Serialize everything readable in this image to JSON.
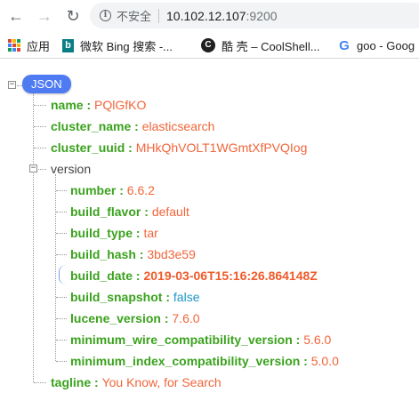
{
  "browser": {
    "back_icon": "←",
    "forward_icon": "→",
    "reload_icon": "↻",
    "security_label": "不安全",
    "url_host": "10.102.12.107",
    "url_port": ":9200"
  },
  "bookmarks": [
    {
      "icon": "apps-grid-icon",
      "label": "应用"
    },
    {
      "icon": "bing-icon",
      "glyph": "b",
      "label": "微软 Bing 搜索 -..."
    },
    {
      "icon": "coolshell-icon",
      "glyph": "C",
      "label": "酷 壳 – CoolShell..."
    },
    {
      "icon": "google-icon",
      "glyph": "G",
      "label": "goo - Goog"
    }
  ],
  "json_viewer": {
    "root_label": "JSON",
    "colors": {
      "key": "#3aa21d",
      "string": "#f0653a",
      "boolean": "#1b96c6",
      "badge": "#4f7bf2"
    },
    "fields": {
      "name": {
        "key": "name",
        "value": "PQlGfKO"
      },
      "cluster_name": {
        "key": "cluster_name",
        "value": "elasticsearch"
      },
      "cluster_uuid": {
        "key": "cluster_uuid",
        "value": "MHkQhVOLT1WGmtXfPVQIog"
      },
      "version": {
        "key": "version"
      },
      "tagline": {
        "key": "tagline",
        "value": "You Know, for Search"
      }
    },
    "version_fields": [
      {
        "key": "number",
        "value": "6.6.2",
        "type": "string"
      },
      {
        "key": "build_flavor",
        "value": "default",
        "type": "string"
      },
      {
        "key": "build_type",
        "value": "tar",
        "type": "string"
      },
      {
        "key": "build_hash",
        "value": "3bd3e59",
        "type": "string"
      },
      {
        "key": "build_date",
        "value": "2019-03-06T15:16:26.864148Z",
        "type": "string",
        "selected": true
      },
      {
        "key": "build_snapshot",
        "value": "false",
        "type": "boolean"
      },
      {
        "key": "lucene_version",
        "value": "7.6.0",
        "type": "string"
      },
      {
        "key": "minimum_wire_compatibility_version",
        "value": "5.6.0",
        "type": "string"
      },
      {
        "key": "minimum_index_compatibility_version",
        "value": "5.0.0",
        "type": "string"
      }
    ],
    "separator": " : ",
    "expanded_sign": "−"
  }
}
